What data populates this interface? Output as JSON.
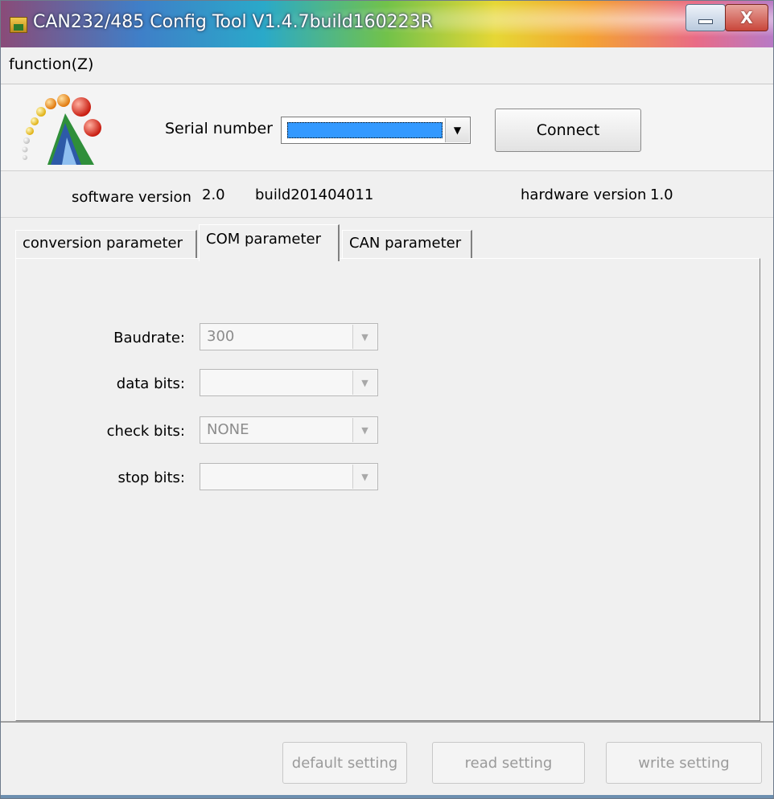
{
  "window": {
    "title": "CAN232/485 Config Tool V1.4.7build160223R",
    "close_glyph": "X"
  },
  "menu": {
    "function_label": "function(Z)"
  },
  "connection": {
    "serial_label": "Serial number",
    "serial_value": "",
    "connect_label": "Connect"
  },
  "version": {
    "software_label": "software version",
    "software_value": "2.0",
    "build_value": "build201404011",
    "hardware_label": "hardware version",
    "hardware_value": "1.0"
  },
  "tabs": [
    {
      "label": "conversion parameter",
      "active": false
    },
    {
      "label": "COM parameter",
      "active": true
    },
    {
      "label": "CAN parameter",
      "active": false
    }
  ],
  "com_params": {
    "baudrate_label": "Baudrate:",
    "baudrate_value": "300",
    "databits_label": "data bits:",
    "databits_value": "",
    "checkbits_label": "check bits:",
    "checkbits_value": "NONE",
    "stopbits_label": "stop bits:",
    "stopbits_value": ""
  },
  "buttons": {
    "default_label": "default setting",
    "read_label": "read setting",
    "write_label": "write setting"
  },
  "colors": {
    "selection": "#3399ff",
    "window_bg": "#f0f0f0",
    "disabled_text": "#9a9a9a"
  },
  "icons": {
    "app_icon": "app-icon",
    "logo": "colorful-balls-logo",
    "minimize": "minimize-icon",
    "close": "close-icon",
    "dropdown": "chevron-down-icon"
  }
}
